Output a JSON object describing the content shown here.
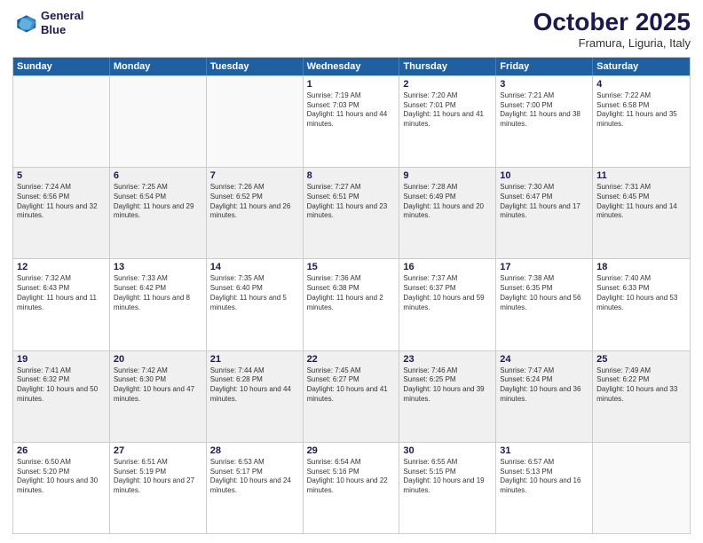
{
  "header": {
    "logo_line1": "General",
    "logo_line2": "Blue",
    "month": "October 2025",
    "location": "Framura, Liguria, Italy"
  },
  "days_of_week": [
    "Sunday",
    "Monday",
    "Tuesday",
    "Wednesday",
    "Thursday",
    "Friday",
    "Saturday"
  ],
  "rows": [
    [
      {
        "day": "",
        "info": ""
      },
      {
        "day": "",
        "info": ""
      },
      {
        "day": "",
        "info": ""
      },
      {
        "day": "1",
        "info": "Sunrise: 7:19 AM\nSunset: 7:03 PM\nDaylight: 11 hours and 44 minutes."
      },
      {
        "day": "2",
        "info": "Sunrise: 7:20 AM\nSunset: 7:01 PM\nDaylight: 11 hours and 41 minutes."
      },
      {
        "day": "3",
        "info": "Sunrise: 7:21 AM\nSunset: 7:00 PM\nDaylight: 11 hours and 38 minutes."
      },
      {
        "day": "4",
        "info": "Sunrise: 7:22 AM\nSunset: 6:58 PM\nDaylight: 11 hours and 35 minutes."
      }
    ],
    [
      {
        "day": "5",
        "info": "Sunrise: 7:24 AM\nSunset: 6:56 PM\nDaylight: 11 hours and 32 minutes."
      },
      {
        "day": "6",
        "info": "Sunrise: 7:25 AM\nSunset: 6:54 PM\nDaylight: 11 hours and 29 minutes."
      },
      {
        "day": "7",
        "info": "Sunrise: 7:26 AM\nSunset: 6:52 PM\nDaylight: 11 hours and 26 minutes."
      },
      {
        "day": "8",
        "info": "Sunrise: 7:27 AM\nSunset: 6:51 PM\nDaylight: 11 hours and 23 minutes."
      },
      {
        "day": "9",
        "info": "Sunrise: 7:28 AM\nSunset: 6:49 PM\nDaylight: 11 hours and 20 minutes."
      },
      {
        "day": "10",
        "info": "Sunrise: 7:30 AM\nSunset: 6:47 PM\nDaylight: 11 hours and 17 minutes."
      },
      {
        "day": "11",
        "info": "Sunrise: 7:31 AM\nSunset: 6:45 PM\nDaylight: 11 hours and 14 minutes."
      }
    ],
    [
      {
        "day": "12",
        "info": "Sunrise: 7:32 AM\nSunset: 6:43 PM\nDaylight: 11 hours and 11 minutes."
      },
      {
        "day": "13",
        "info": "Sunrise: 7:33 AM\nSunset: 6:42 PM\nDaylight: 11 hours and 8 minutes."
      },
      {
        "day": "14",
        "info": "Sunrise: 7:35 AM\nSunset: 6:40 PM\nDaylight: 11 hours and 5 minutes."
      },
      {
        "day": "15",
        "info": "Sunrise: 7:36 AM\nSunset: 6:38 PM\nDaylight: 11 hours and 2 minutes."
      },
      {
        "day": "16",
        "info": "Sunrise: 7:37 AM\nSunset: 6:37 PM\nDaylight: 10 hours and 59 minutes."
      },
      {
        "day": "17",
        "info": "Sunrise: 7:38 AM\nSunset: 6:35 PM\nDaylight: 10 hours and 56 minutes."
      },
      {
        "day": "18",
        "info": "Sunrise: 7:40 AM\nSunset: 6:33 PM\nDaylight: 10 hours and 53 minutes."
      }
    ],
    [
      {
        "day": "19",
        "info": "Sunrise: 7:41 AM\nSunset: 6:32 PM\nDaylight: 10 hours and 50 minutes."
      },
      {
        "day": "20",
        "info": "Sunrise: 7:42 AM\nSunset: 6:30 PM\nDaylight: 10 hours and 47 minutes."
      },
      {
        "day": "21",
        "info": "Sunrise: 7:44 AM\nSunset: 6:28 PM\nDaylight: 10 hours and 44 minutes."
      },
      {
        "day": "22",
        "info": "Sunrise: 7:45 AM\nSunset: 6:27 PM\nDaylight: 10 hours and 41 minutes."
      },
      {
        "day": "23",
        "info": "Sunrise: 7:46 AM\nSunset: 6:25 PM\nDaylight: 10 hours and 39 minutes."
      },
      {
        "day": "24",
        "info": "Sunrise: 7:47 AM\nSunset: 6:24 PM\nDaylight: 10 hours and 36 minutes."
      },
      {
        "day": "25",
        "info": "Sunrise: 7:49 AM\nSunset: 6:22 PM\nDaylight: 10 hours and 33 minutes."
      }
    ],
    [
      {
        "day": "26",
        "info": "Sunrise: 6:50 AM\nSunset: 5:20 PM\nDaylight: 10 hours and 30 minutes."
      },
      {
        "day": "27",
        "info": "Sunrise: 6:51 AM\nSunset: 5:19 PM\nDaylight: 10 hours and 27 minutes."
      },
      {
        "day": "28",
        "info": "Sunrise: 6:53 AM\nSunset: 5:17 PM\nDaylight: 10 hours and 24 minutes."
      },
      {
        "day": "29",
        "info": "Sunrise: 6:54 AM\nSunset: 5:16 PM\nDaylight: 10 hours and 22 minutes."
      },
      {
        "day": "30",
        "info": "Sunrise: 6:55 AM\nSunset: 5:15 PM\nDaylight: 10 hours and 19 minutes."
      },
      {
        "day": "31",
        "info": "Sunrise: 6:57 AM\nSunset: 5:13 PM\nDaylight: 10 hours and 16 minutes."
      },
      {
        "day": "",
        "info": ""
      }
    ]
  ]
}
